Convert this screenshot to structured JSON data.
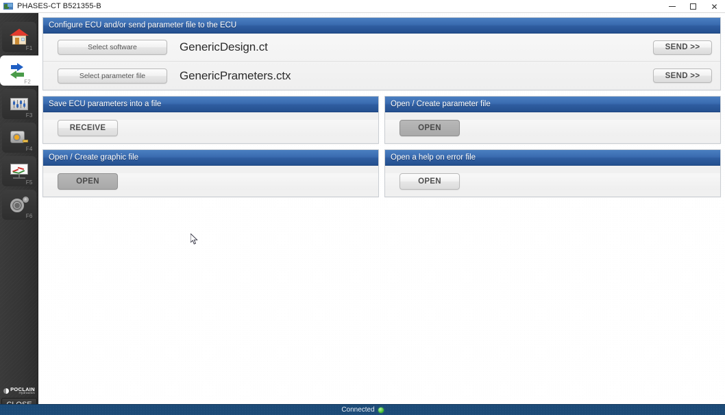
{
  "window": {
    "title": "PHASES-CT B521355-B",
    "app_icon": "app-icon",
    "minimize_label": "–",
    "maximize_label": "□",
    "close_label": "✕"
  },
  "sidebar": {
    "items": [
      {
        "name": "home",
        "icon": "home-icon",
        "fkey": "F1",
        "active": false
      },
      {
        "name": "transfer",
        "icon": "exchange-arrows-icon",
        "fkey": "F2",
        "active": true
      },
      {
        "name": "parameters",
        "icon": "sliders-icon",
        "fkey": "F3",
        "active": false
      },
      {
        "name": "measure",
        "icon": "tape-measure-icon",
        "fkey": "F4",
        "active": false
      },
      {
        "name": "graph",
        "icon": "chart-board-icon",
        "fkey": "F5",
        "active": false
      },
      {
        "name": "settings",
        "icon": "gear-icon",
        "fkey": "F6",
        "active": false
      }
    ],
    "brand": {
      "main": "POCLAIN",
      "sub": "Hydraulics"
    },
    "close_button": "CLOSE"
  },
  "main": {
    "configure_panel": {
      "title": "Configure ECU and/or send parameter file to the ECU",
      "rows": [
        {
          "select_label": "Select software",
          "file_name": "GenericDesign.ct",
          "send_label": "SEND >>"
        },
        {
          "select_label": "Select parameter file",
          "file_name": "GenericPrameters.ctx",
          "send_label": "SEND >>"
        }
      ]
    },
    "save_panel": {
      "title": "Save ECU parameters into a file",
      "button_label": "RECEIVE",
      "button_state": "normal"
    },
    "open_parameter_panel": {
      "title": "Open / Create parameter file",
      "button_label": "OPEN",
      "button_state": "pressed"
    },
    "open_graphic_panel": {
      "title": "Open / Create graphic file",
      "button_label": "OPEN",
      "button_state": "pressed"
    },
    "help_panel": {
      "title": "Open a help on error file",
      "button_label": "OPEN",
      "button_state": "normal"
    }
  },
  "statusbar": {
    "text": "Connected",
    "indicator": "green-status-dot"
  },
  "colors": {
    "panel_header_blue": "#2f5da0",
    "sidebar_dark": "#343434",
    "statusbar_blue": "#1b4a77",
    "status_green": "#3fbb2a"
  }
}
